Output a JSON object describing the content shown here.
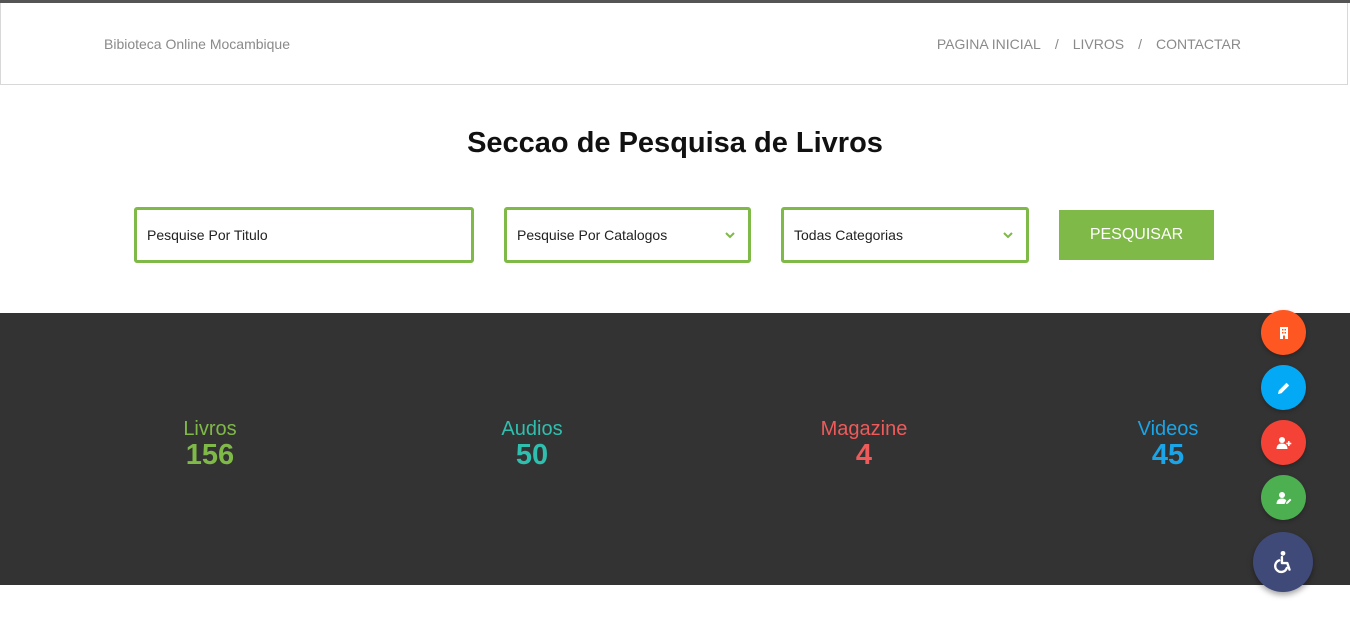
{
  "header": {
    "brand": "Bibioteca Online Mocambique",
    "nav": [
      "PAGINA INICIAL",
      "LIVROS",
      "CONTACTAR"
    ],
    "separator": "/"
  },
  "search": {
    "title": "Seccao de Pesquisa de Livros",
    "title_placeholder": "Pesquise Por Titulo",
    "catalog_select": "Pesquise Por Catalogos",
    "category_select": "Todas Categorias",
    "button": "PESQUISAR",
    "accent": "#7fb947"
  },
  "stats": [
    {
      "label": "Livros",
      "value": "156",
      "color": "#7fb947"
    },
    {
      "label": "Audios",
      "value": "50",
      "color": "#2fbfae"
    },
    {
      "label": "Magazine",
      "value": "4",
      "color": "#ef5a5a"
    },
    {
      "label": "Videos",
      "value": "45",
      "color": "#1aa5e8"
    }
  ],
  "floating_buttons": [
    {
      "icon": "building-icon",
      "color": "#ff5722"
    },
    {
      "icon": "pencil-icon",
      "color": "#03a9f4"
    },
    {
      "icon": "user-plus-icon",
      "color": "#f44336"
    },
    {
      "icon": "user-edit-icon",
      "color": "#4caf50"
    }
  ],
  "accessibility": {
    "icon": "accessibility-icon",
    "color": "#404a78"
  }
}
